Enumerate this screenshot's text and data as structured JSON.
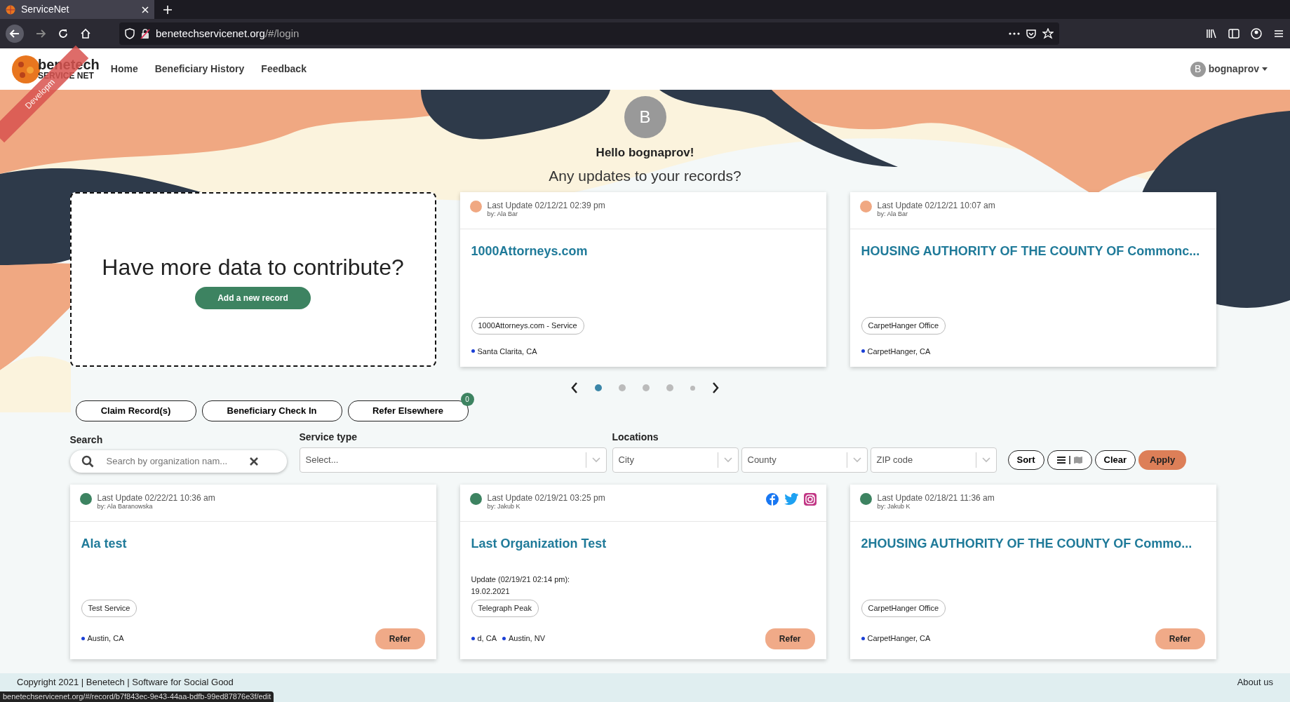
{
  "browser": {
    "tab_title": "ServiceNet",
    "url_host": "benetechservicenet.org",
    "url_path": "/#/login"
  },
  "nav": {
    "brand": "benetech",
    "brand_sub": "SERVICE NET",
    "ribbon": "Developm",
    "links": [
      "Home",
      "Beneficiary History",
      "Feedback"
    ],
    "user_initial": "B",
    "user_name": "bognaprov"
  },
  "hero": {
    "avatar_initial": "B",
    "greeting": "Hello bognaprov!",
    "question": "Any updates to your records?"
  },
  "contribute": {
    "title": "Have more data to contribute?",
    "button": "Add a new record"
  },
  "featured": [
    {
      "color": "#f0a882",
      "last_update": "Last Update 02/12/21 02:39 pm",
      "by": "by: Ala Bar",
      "title": "1000Attorneys.com",
      "tags": [
        "1000Attorneys.com - Service"
      ],
      "locations": [
        "Santa Clarita, CA"
      ]
    },
    {
      "color": "#f0a882",
      "last_update": "Last Update 02/12/21 10:07 am",
      "by": "by: Ala Bar",
      "title": "HOUSING AUTHORITY OF THE COUNTY OF Commonc...",
      "tags": [
        "CarpetHanger Office"
      ],
      "locations": [
        "CarpetHanger, CA"
      ]
    }
  ],
  "carousel": {
    "dots": [
      {
        "selected": true
      },
      {
        "selected": false
      },
      {
        "selected": false
      },
      {
        "selected": false
      },
      {
        "selected": false
      }
    ]
  },
  "actions": [
    {
      "label": "Claim Record(s)"
    },
    {
      "label": "Beneficiary Check In"
    },
    {
      "label": "Refer Elsewhere",
      "badge": "0"
    }
  ],
  "filters": {
    "search_label": "Search",
    "search_placeholder": "Search by organization nam...",
    "service_label": "Service type",
    "service_placeholder": "Select...",
    "locations_label": "Locations",
    "location_fields": [
      "City",
      "County",
      "ZIP code"
    ],
    "sort": "Sort",
    "list_view_selected": true,
    "clear": "Clear",
    "apply": "Apply"
  },
  "records": [
    {
      "color": "#3d8361",
      "last_update": "Last Update 02/22/21 10:36 am",
      "by": "by: Ala Baranowska",
      "title": "Ala test",
      "social": false,
      "tags": [
        "Test Service"
      ],
      "locations": [
        "Austin, CA"
      ],
      "refer": "Refer"
    },
    {
      "color": "#3d8361",
      "last_update": "Last Update 02/19/21 03:25 pm",
      "by": "by: Jakub K",
      "title": "Last Organization Test",
      "social": true,
      "update_note": "Update (02/19/21 02:14 pm):\n19.02.2021",
      "tags": [
        "Telegraph Peak"
      ],
      "locations": [
        "d, CA",
        "Austin, NV"
      ],
      "refer": "Refer"
    },
    {
      "color": "#3d8361",
      "last_update": "Last Update 02/18/21 11:36 am",
      "by": "by: Jakub K",
      "title": "2HOUSING AUTHORITY OF THE COUNTY OF Commo...",
      "social": false,
      "tags": [
        "CarpetHanger Office"
      ],
      "locations": [
        "CarpetHanger, CA"
      ],
      "refer": "Refer"
    }
  ],
  "footer": {
    "copyright": "Copyright 2021 | Benetech | Software for Social Good",
    "about": "About us",
    "status_url": "benetechservicenet.org/#/record/b7f843ec-9e43-44aa-bdfb-99ed87876e3f/edit"
  }
}
